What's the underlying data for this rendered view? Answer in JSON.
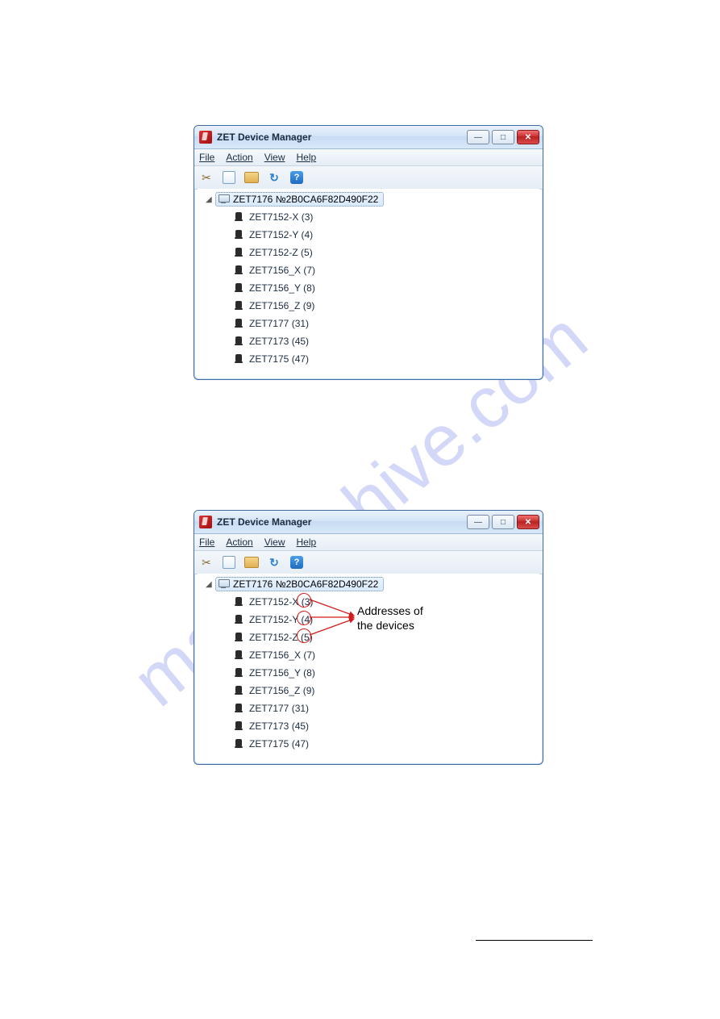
{
  "watermark": "manualshive.com",
  "window": {
    "title": "ZET Device Manager",
    "menu": {
      "file": "File",
      "action": "Action",
      "view": "View",
      "help": "Help"
    },
    "root": "ZET7176 №2B0CA6F82D490F22",
    "children": [
      "ZET7152-X (3)",
      "ZET7152-Y (4)",
      "ZET7152-Z (5)",
      "ZET7156_X (7)",
      "ZET7156_Y (8)",
      "ZET7156_Z (9)",
      "ZET7177 (31)",
      "ZET7173 (45)",
      "ZET7175 (47)"
    ]
  },
  "annotation": {
    "label_l1": "Addresses of",
    "label_l2": "the devices"
  }
}
